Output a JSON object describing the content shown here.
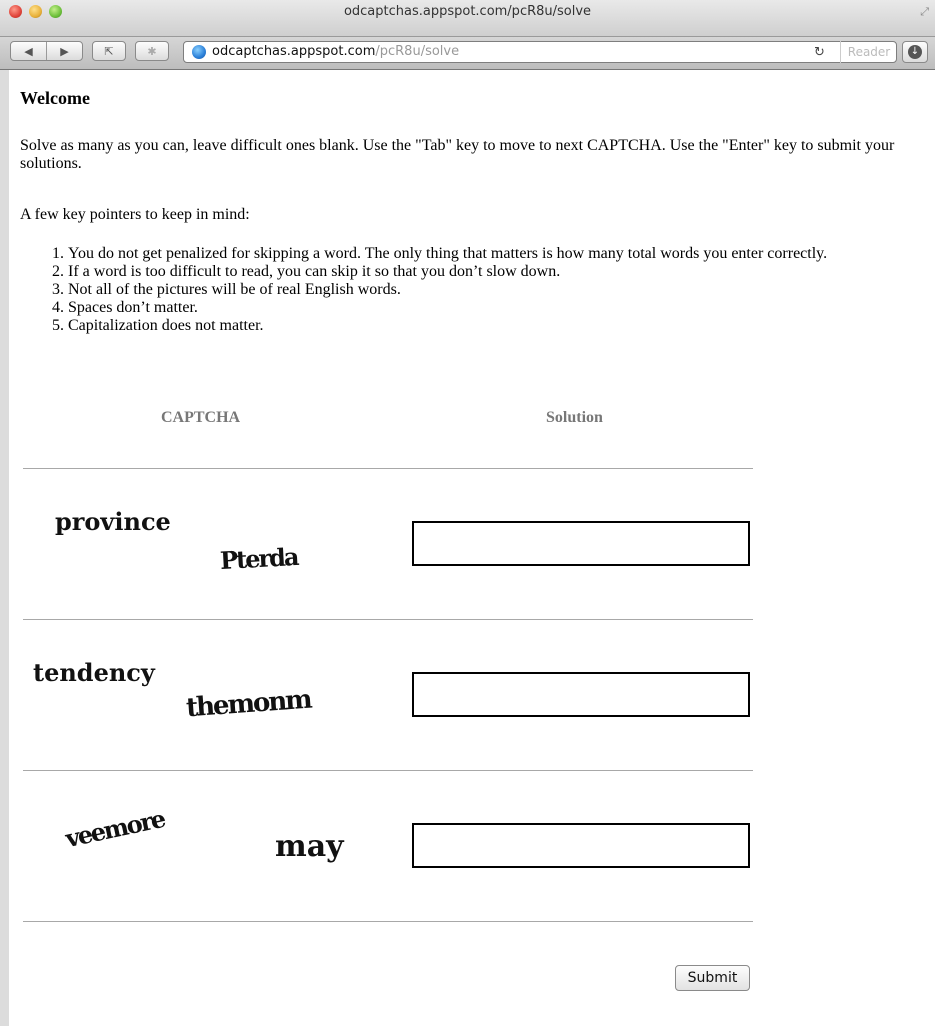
{
  "browser": {
    "window_title": "odcaptchas.appspot.com/pcR8u/solve",
    "url_host": "odcaptchas.appspot.com",
    "url_path": "/pcR8u/solve",
    "reader_label": "Reader"
  },
  "page": {
    "heading": "Welcome",
    "intro": "Solve as many as you can, leave difficult ones blank. Use the \"Tab\" key to move to next CAPTCHA. Use the \"Enter\" key to submit your solutions.",
    "pointers_intro": "A few key pointers to keep in mind:",
    "pointers": [
      "You do not get penalized for skipping a word. The only thing that matters is how many total words you enter correctly.",
      "If a word is too difficult to read, you can skip it so that you don’t slow down.",
      "Not all of the pictures will be of real English words.",
      "Spaces don’t matter.",
      "Capitalization does not matter."
    ],
    "col_captcha": "CAPTCHA",
    "col_solution": "Solution",
    "captchas": [
      {
        "word1": "province",
        "word2": "Pterda",
        "solution": ""
      },
      {
        "word1": "tendency",
        "word2": "themonm",
        "solution": ""
      },
      {
        "word1": "veemore",
        "word2": "may",
        "solution": ""
      }
    ],
    "submit_label": "Submit"
  }
}
